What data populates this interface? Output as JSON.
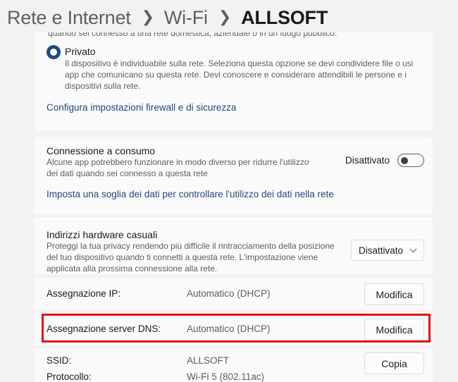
{
  "breadcrumb": {
    "items": [
      "Rete e Internet",
      "Wi-Fi"
    ],
    "current": "ALLSOFT"
  },
  "network_profile": {
    "cut_text": "quando sei connesso a una rete domestica, aziendale o in un luogo pubblico.",
    "private_label": "Privato",
    "private_desc": "Il dispositivo è individuabile sulla rete. Seleziona questa opzione se devi condividere file o usi app che comunicano su questa rete. Devi conoscere e considerare attendibili le persone e i dispositivi sulla rete.",
    "firewall_link": "Configura impostazioni firewall e di sicurezza"
  },
  "metered": {
    "title": "Connessione a consumo",
    "desc": "Alcune app potrebbero funzionare in modo diverso per ridurre l'utilizzo dei dati quando sei connesso a questa rete",
    "state": "Disattivato",
    "data_limit_link": "Imposta una soglia dei dati per controllare l'utilizzo dei dati nella rete"
  },
  "random_mac": {
    "title": "Indirizzi hardware casuali",
    "desc": "Proteggi la tua privacy rendendo più difficile il rintracciamento della posizione del tuo dispositivo quando ti connetti a questa rete. L'impostazione viene applicata alla prossima connessione alla rete.",
    "value": "Disattivato"
  },
  "properties": {
    "ip_label": "Assegnazione IP:",
    "ip_value": "Automatico (DHCP)",
    "ip_button": "Modifica",
    "dns_label": "Assegnazione server DNS:",
    "dns_value": "Automatico (DHCP)",
    "dns_button": "Modifica",
    "ssid_label": "SSID:",
    "ssid_value": "ALLSOFT",
    "protocol_label": "Protocollo:",
    "protocol_value": "Wi-Fi 5 (802.11ac)",
    "copy_button": "Copia"
  },
  "colors": {
    "accent": "#1f4a7c",
    "highlight": "#e41212"
  }
}
